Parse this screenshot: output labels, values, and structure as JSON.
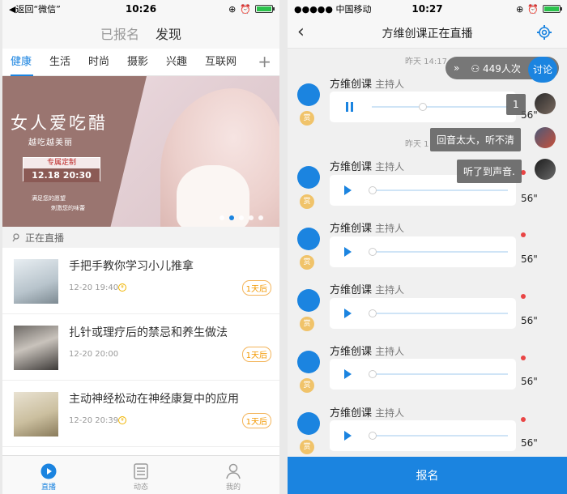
{
  "left": {
    "status": {
      "back_label": "◀返回“微信”",
      "time": "10:26"
    },
    "segments": [
      "已报名",
      "发现"
    ],
    "tabs": [
      "健康",
      "生活",
      "时尚",
      "摄影",
      "兴趣",
      "互联网"
    ],
    "banner": {
      "title": "女人爱吃醋",
      "subtitle": "越吃越美丽",
      "custom_label": "专属定制",
      "datetime": "12.18 20:30",
      "line1": "满足您的愿望",
      "line2": "刺激您的味蕾"
    },
    "section_title": "正在直播",
    "items": [
      {
        "title": "手把手教你学习小儿推拿",
        "date": "12-20 19:40",
        "badge": "1天后"
      },
      {
        "title": "扎针或理疗后的禁忌和养生做法",
        "date": "12-20 20:00",
        "badge": "1天后"
      },
      {
        "title": "主动神经松动在神经康复中的应用",
        "date": "12-20 20:39",
        "badge": "1天后"
      }
    ],
    "nav": [
      "直播",
      "动态",
      "我的"
    ]
  },
  "right": {
    "status": {
      "carrier": "●●●●● 中国移动",
      "time": "10:27"
    },
    "title": "方维创课正在直播",
    "timestamp1": "昨天 14:17",
    "timestamp2": "昨天 1",
    "viewers": "449人次",
    "discuss": "讨论",
    "sender": "方维创课",
    "role": "主持人",
    "reward": "赏",
    "duration": "56\"",
    "comments": [
      "1",
      "回音太大，听不清",
      "听了到声音."
    ],
    "signup": "报名"
  }
}
